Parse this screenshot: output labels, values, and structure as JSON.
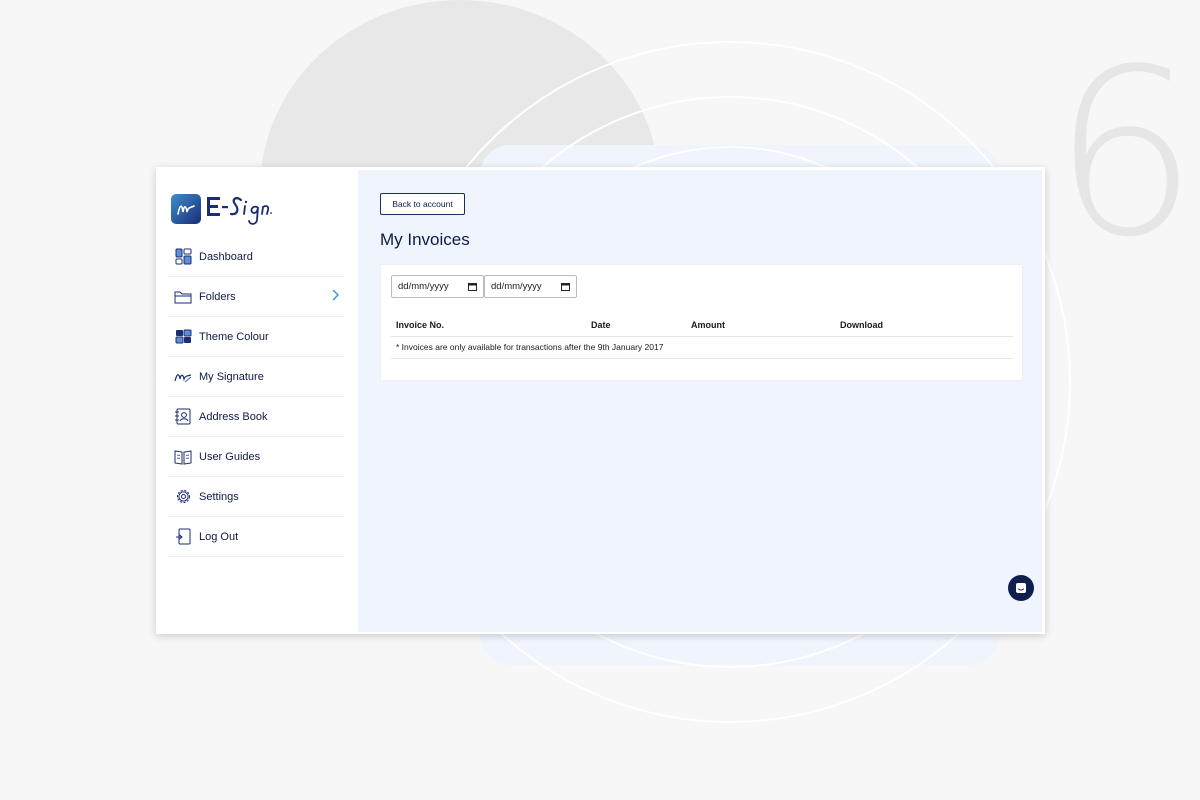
{
  "background": {
    "step_number": "6"
  },
  "brand": {
    "name": "E-Sign",
    "accent": "#1b2c74"
  },
  "sidebar": {
    "items": [
      {
        "label": "Dashboard",
        "icon": "dashboard-icon"
      },
      {
        "label": "Folders",
        "icon": "folder-icon",
        "has_submenu": true
      },
      {
        "label": "Theme Colour",
        "icon": "theme-colour-icon"
      },
      {
        "label": "My Signature",
        "icon": "signature-icon"
      },
      {
        "label": "Address Book",
        "icon": "address-book-icon"
      },
      {
        "label": "User Guides",
        "icon": "user-guides-icon"
      },
      {
        "label": "Settings",
        "icon": "gear-icon"
      },
      {
        "label": "Log Out",
        "icon": "log-out-icon"
      }
    ]
  },
  "main": {
    "back_label": "Back to account",
    "title": "My Invoices",
    "filters": {
      "date_from_placeholder": "dd/mm/yyyy",
      "date_to_placeholder": "dd/mm/yyyy"
    },
    "table": {
      "columns": [
        "Invoice No.",
        "Date",
        "Amount",
        "Download"
      ],
      "note": "* Invoices are only available for transactions after the 9th January 2017"
    }
  },
  "chat": {
    "icon": "chat-icon"
  }
}
